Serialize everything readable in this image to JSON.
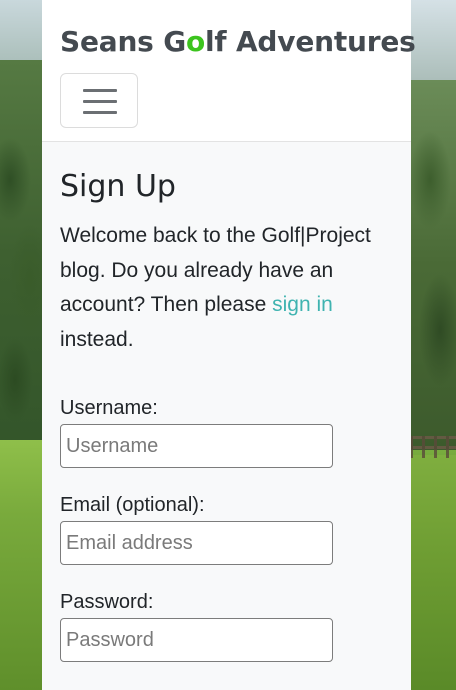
{
  "brand": {
    "prefix": "Seans G",
    "accent_letter": "o",
    "suffix": "lf Adventures",
    "accent_color": "#3cc41e"
  },
  "navbar": {
    "toggler_icon": "hamburger-menu-icon"
  },
  "page": {
    "heading": "Sign Up",
    "intro_text_before": "Welcome back to the Golf|Project blog. Do you already have an account? Then please ",
    "intro_link": "sign in",
    "intro_text_after": " instead.",
    "link_color": "#3fb3b0"
  },
  "form": {
    "username": {
      "label": "Username:",
      "placeholder": "Username",
      "value": ""
    },
    "email": {
      "label": "Email (optional):",
      "placeholder": "Email address",
      "value": ""
    },
    "password": {
      "label": "Password:",
      "placeholder": "Password",
      "value": ""
    }
  }
}
